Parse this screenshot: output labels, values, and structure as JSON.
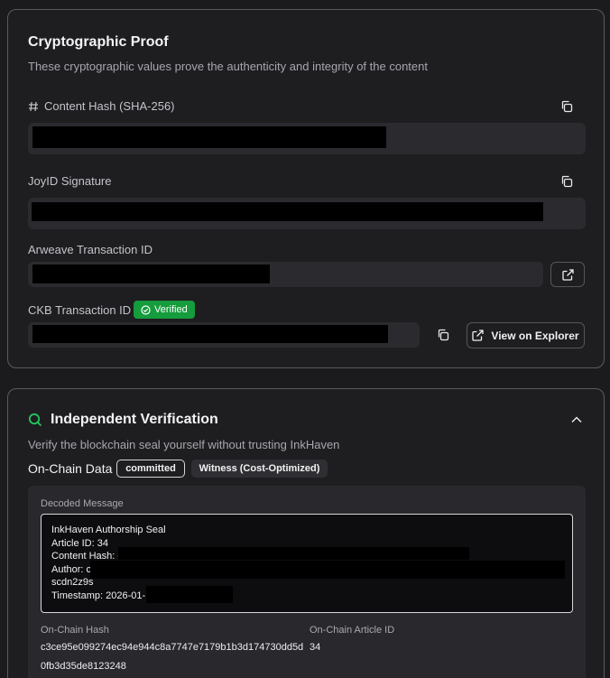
{
  "proof": {
    "title": "Cryptographic Proof",
    "subtitle": "These cryptographic values prove the authenticity and integrity of the content",
    "content_hash_label": "Content Hash (SHA-256)",
    "joyid_label": "JoyID Signature",
    "arweave_label": "Arweave Transaction ID",
    "ckb_label": "CKB Transaction ID",
    "verified_badge": "Verified",
    "view_explorer": "View on Explorer"
  },
  "verification": {
    "title": "Independent Verification",
    "subtitle": "Verify the blockchain seal yourself without trusting InkHaven",
    "onchain_label": "On-Chain Data",
    "status_pill": "committed",
    "mode_pill": "Witness (Cost-Optimized)",
    "decoded_label": "Decoded Message",
    "message_lines": [
      "InkHaven Authorship Seal",
      "Article ID: 34",
      "Content Hash: c",
      "Author: c",
      "scdn2z9s",
      "Timestamp: 2026-01-"
    ],
    "onchain_hash_label": "On-Chain Hash",
    "onchain_hash_line1": "c3ce95e099274ec94e944c8a7747e7179b1b3d174730dd5d",
    "onchain_hash_line2": "0fb3d35de8123248",
    "onchain_article_label": "On-Chain Article ID",
    "onchain_article_value": "34"
  },
  "colors": {
    "accent_green": "#159c3c",
    "search_icon_green": "#22c55e"
  },
  "icons": [
    "hash-icon",
    "copy-icon",
    "external-link-icon",
    "check-circle-icon",
    "search-icon",
    "chevron-up-icon"
  ]
}
